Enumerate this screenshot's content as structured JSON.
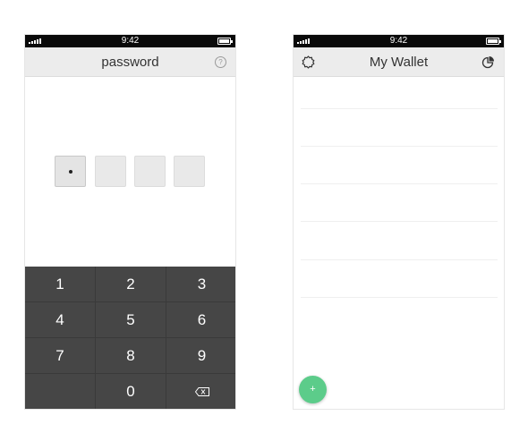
{
  "status_bar": {
    "time": "9:42"
  },
  "password_screen": {
    "title": "password",
    "help_icon": "?",
    "code_length": 4,
    "digits_entered": 1,
    "keypad": {
      "keys": [
        "1",
        "2",
        "3",
        "4",
        "5",
        "6",
        "7",
        "8",
        "9",
        "",
        "0",
        "backspace"
      ]
    }
  },
  "wallet_screen": {
    "title": "My Wallet",
    "settings_icon": "gear-icon",
    "chart_icon": "pie-chart-icon",
    "add_button_label": "+"
  },
  "colors": {
    "status_bar": "#0a0a0a",
    "nav_bar": "#ececec",
    "keypad": "#464646",
    "fab": "#5ccc8a"
  }
}
